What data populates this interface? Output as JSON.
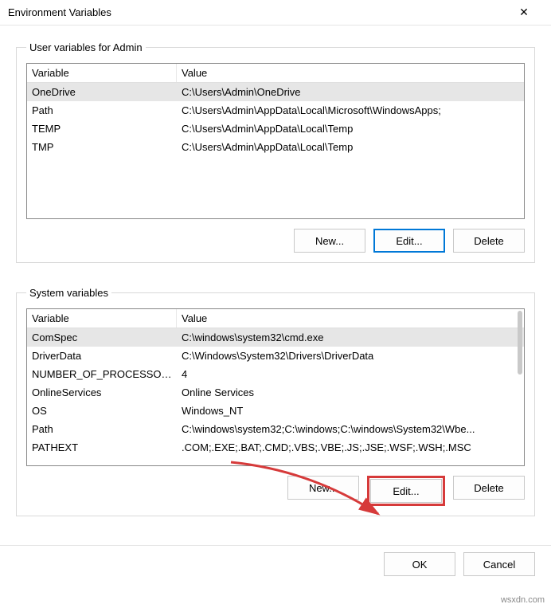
{
  "window": {
    "title": "Environment Variables",
    "close_label": "✕"
  },
  "user_group": {
    "legend": "User variables for Admin",
    "headers": {
      "variable": "Variable",
      "value": "Value"
    },
    "rows": [
      {
        "variable": "OneDrive",
        "value": "C:\\Users\\Admin\\OneDrive",
        "selected": true
      },
      {
        "variable": "Path",
        "value": "C:\\Users\\Admin\\AppData\\Local\\Microsoft\\WindowsApps;",
        "selected": false
      },
      {
        "variable": "TEMP",
        "value": "C:\\Users\\Admin\\AppData\\Local\\Temp",
        "selected": false
      },
      {
        "variable": "TMP",
        "value": "C:\\Users\\Admin\\AppData\\Local\\Temp",
        "selected": false
      }
    ],
    "buttons": {
      "new": "New...",
      "edit": "Edit...",
      "delete": "Delete"
    }
  },
  "system_group": {
    "legend": "System variables",
    "headers": {
      "variable": "Variable",
      "value": "Value"
    },
    "rows": [
      {
        "variable": "ComSpec",
        "value": "C:\\windows\\system32\\cmd.exe",
        "selected": true
      },
      {
        "variable": "DriverData",
        "value": "C:\\Windows\\System32\\Drivers\\DriverData",
        "selected": false
      },
      {
        "variable": "NUMBER_OF_PROCESSORS",
        "value": "4",
        "selected": false
      },
      {
        "variable": "OnlineServices",
        "value": "Online Services",
        "selected": false
      },
      {
        "variable": "OS",
        "value": "Windows_NT",
        "selected": false
      },
      {
        "variable": "Path",
        "value": "C:\\windows\\system32;C:\\windows;C:\\windows\\System32\\Wbe...",
        "selected": false
      },
      {
        "variable": "PATHEXT",
        "value": ".COM;.EXE;.BAT;.CMD;.VBS;.VBE;.JS;.JSE;.WSF;.WSH;.MSC",
        "selected": false
      }
    ],
    "buttons": {
      "new": "New...",
      "edit": "Edit...",
      "delete": "Delete"
    }
  },
  "dialog_buttons": {
    "ok": "OK",
    "cancel": "Cancel"
  },
  "watermark": "wsxdn.com"
}
